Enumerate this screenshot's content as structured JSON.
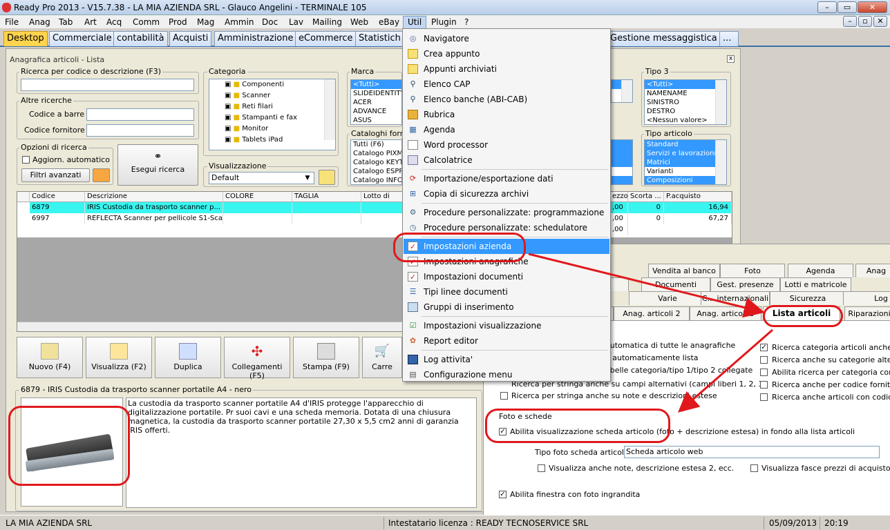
{
  "window": {
    "title": "Ready Pro 2013 - V15.7.38 - LA MIA AZIENDA SRL - Glauco Angelini - TERMINALE 105"
  },
  "menubar": [
    "File",
    "Anag",
    "Tab",
    "Art",
    "Acq",
    "Comm",
    "Prod",
    "Mag",
    "Ammin",
    "Doc",
    "Lav",
    "Mailing",
    "Web",
    "eBay",
    "Util",
    "Plugin",
    "?"
  ],
  "tabs": [
    "Desktop",
    "Commerciale",
    "contabilità",
    "Acquisti",
    "Amministrazione",
    "eCommerce",
    "Statistich",
    "Gestione messaggistica",
    "..."
  ],
  "panel": {
    "title": "Anagrafica articoli  - Lista",
    "search_legend": "Ricerca per codice o descrizione (F3)",
    "altre_legend": "Altre ricerche",
    "barcode_label": "Codice a barre :",
    "supplier_code_label": "Codice fornitore :",
    "options_legend": "Opzioni di ricerca",
    "auto_update_label": "Aggiorn. automatico",
    "advanced_filters": "Filtri avanzati",
    "search_button": "Esegui ricerca",
    "category_legend": "Categoria",
    "categories": [
      "Componenti",
      "Scanner",
      "Reti filari",
      "Stampanti e fax",
      "Monitor",
      "Tablets iPad"
    ],
    "view_legend": "Visualizzazione",
    "view_value": "Default",
    "brand_legend": "Marca",
    "brands": [
      "<Tutti>",
      "SLIDEIDENTITY",
      "ACER",
      "ADVANCE",
      "ASUS"
    ],
    "catalogs_legend": "Cataloghi forni",
    "catalogs": [
      "Tutti (F6)",
      "Catalogo PIXMA",
      "Catalogo KEYTE",
      "Catalogo ESPRI",
      "Catalogo INFO"
    ],
    "tipo3_legend": "Tipo 3",
    "tipo3": [
      "<Tutti>",
      "NAMENAME",
      "SINISTRO",
      "DESTRO",
      "<Nessun valore>"
    ],
    "tipo_articolo_legend": "Tipo articolo",
    "tipo_articolo": [
      "Standard",
      "Servizi e lavorazioni",
      "Matrici",
      "Varianti",
      "Composizioni"
    ]
  },
  "grid": {
    "columns": [
      "Codice",
      "Descrizione",
      "COLORE",
      "TAGLIA",
      "Lotto di sca",
      "ezzo",
      "Scorta ...",
      "P.acquisto"
    ],
    "rows": [
      [
        "6879",
        "IRIS Custodia da trasporto scanner p...",
        "",
        "",
        "",
        ",00",
        "0",
        "16,94"
      ],
      [
        "6997",
        "REFLECTA Scanner per pellicole S1-Scan",
        "",
        "",
        "",
        ",00",
        "0",
        "67,27"
      ],
      [
        "",
        "",
        "",
        "",
        "",
        ",00",
        "",
        ""
      ]
    ]
  },
  "toolbar": [
    "Nuovo (F4)",
    "Visualizza (F2)",
    "Duplica",
    "Collegamenti (F5)",
    "Stampa (F9)",
    "Carre"
  ],
  "detail": {
    "title": "6879 - IRIS Custodia da trasporto scanner portatile A4 - nero",
    "text": "La custodia da trasporto scanner portatile A4 d'IRIS protegge l'apparecchio di digitalizzazione portatile. Pr suoi cavi e una scheda memoria. Dotata di una chiusura magnetica, la custodia da trasporto scanner portatile 27,30 x 5,5 cm2 anni di garanzia IRIS offerti."
  },
  "util_menu": [
    {
      "label": "Navigatore",
      "icon": "navigator-icon"
    },
    {
      "label": "Crea appunto",
      "icon": "note-icon"
    },
    {
      "label": "Appunti archiviati",
      "icon": "notes-archive-icon"
    },
    {
      "label": "Elenco CAP",
      "icon": "magnifier-icon"
    },
    {
      "label": "Elenco banche (ABI-CAB)",
      "icon": "magnifier-icon"
    },
    {
      "label": "Rubrica",
      "icon": "address-book-icon"
    },
    {
      "label": "Agenda",
      "icon": "agenda-icon"
    },
    {
      "label": "Word processor",
      "icon": "word-processor-icon"
    },
    {
      "label": "Calcolatrice",
      "icon": "calculator-icon"
    },
    {
      "label": "Importazione/esportazione dati",
      "icon": "import-export-icon"
    },
    {
      "label": "Copia di sicurezza archivi",
      "icon": "backup-icon"
    },
    {
      "label": "Procedure personalizzate: programmazione",
      "icon": "gear-icon"
    },
    {
      "label": "Procedure personalizzate: schedulatore",
      "icon": "clock-icon"
    },
    {
      "label": "Impostazioni azienda",
      "icon": "settings-check-icon"
    },
    {
      "label": "Impostazioni anagrafiche",
      "icon": "settings-check-icon"
    },
    {
      "label": "Impostazioni documenti",
      "icon": "settings-check-icon"
    },
    {
      "label": "Tipi linee documenti",
      "icon": "lines-icon"
    },
    {
      "label": "Gruppi di inserimento",
      "icon": "window-icon"
    },
    {
      "label": "Impostazioni visualizzazione",
      "icon": "display-icon"
    },
    {
      "label": "Report editor",
      "icon": "palette-icon"
    },
    {
      "label": "Log attivita'",
      "icon": "book-icon"
    },
    {
      "label": "Configurazione menu",
      "icon": "menu-config-icon"
    }
  ],
  "settings": {
    "tabs_row1": [
      "h",
      "Vendita al banco",
      "Foto",
      "Agenda",
      "Anag"
    ],
    "tabs_row2": [
      "ioni",
      "Documenti",
      "Gest. presenze",
      "Lotti e matricole"
    ],
    "tabs_row3": [
      "Varie",
      "C... internazionali",
      "Sicurezza",
      "Log"
    ],
    "tabs_row4": [
      "i",
      "Anag. articoli 2",
      "Anag. articoli 3",
      "Lista articoli",
      "Riparazioni"
    ],
    "left_options": [
      "automatica di tutte le anagrafiche",
      "a automaticamente lista",
      "abelle categoria/tipo 1/tipo 2 collegate",
      "Ricerca per stringa anche su campi alternativi (campi liberi 1, 2, 3)",
      "Ricerca per stringa anche su note e descrizioni estese"
    ],
    "right_options": [
      {
        "label": "Ricerca categoria articoli anche su n",
        "checked": true
      },
      {
        "label": "Ricerca anche su categorie alternati",
        "checked": false
      },
      {
        "label": "Abilita ricerca per categoria con sele",
        "checked": false
      },
      {
        "label": "Ricerca anche per codice fornitore",
        "checked": false
      },
      {
        "label": "Ricerca anche articoli con codice sim",
        "checked": false
      }
    ],
    "foto_legend": "Foto e schede",
    "foto_check": "Abilita visualizzazione scheda articolo (foto + descrizione estesa) in fondo alla lista articoli",
    "tipo_foto_label": "Tipo foto scheda articolo :",
    "tipo_foto_value": "Scheda articolo web",
    "note_check": "Visualizza anche note, descrizione estesa 2, ecc.",
    "fasce_check": "Visualizza fasce prezzi di acquisto forni",
    "finestra_check": "Abilita finestra con foto ingrandita"
  },
  "status": {
    "company": "LA MIA AZIENDA SRL",
    "license": "Intestatario licenza : READY TECNOSERVICE SRL",
    "date": "05/09/2013",
    "time": "20:19"
  }
}
